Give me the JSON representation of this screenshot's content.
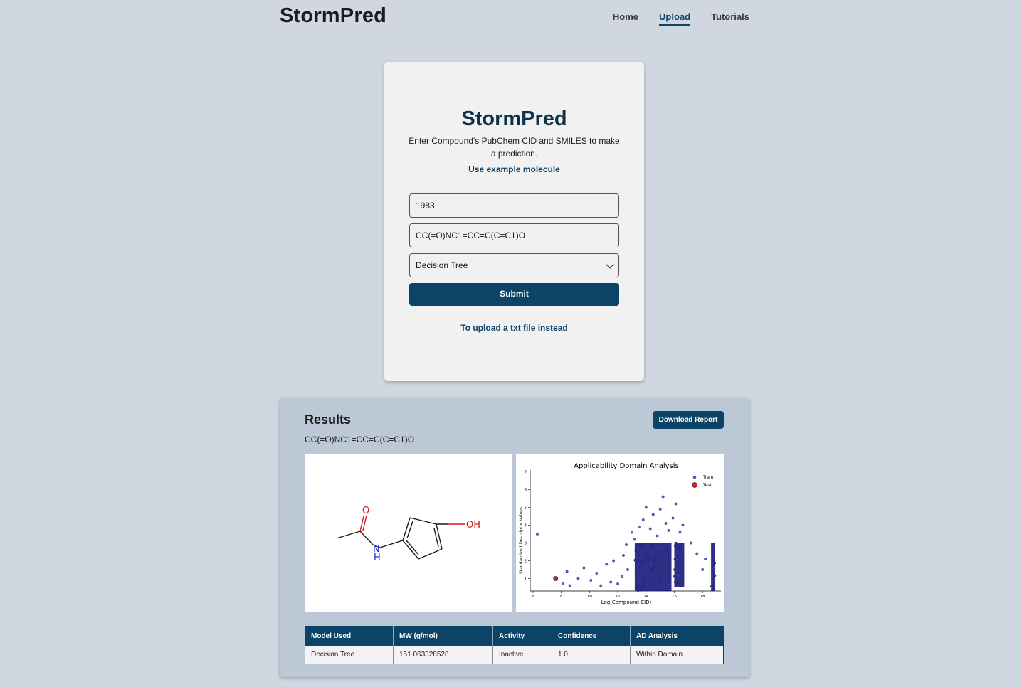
{
  "brand": "StormPred",
  "nav": {
    "home": "Home",
    "upload": "Upload",
    "tutorials": "Tutorials",
    "active": "Upload"
  },
  "form": {
    "title": "StormPred",
    "subtitle": "Enter Compound's PubChem CID and SMILES to make a prediction.",
    "example_link": "Use example molecule",
    "cid_value": "1983",
    "smiles_value": "CC(=O)NC1=CC=C(C=C1)O",
    "model_selected": "Decision Tree",
    "submit_label": "Submit",
    "upload_link": "To upload a txt file instead"
  },
  "results": {
    "title": "Results",
    "download_label": "Download Report",
    "smiles": "CC(=O)NC1=CC=C(C=C1)O",
    "molecule_labels": {
      "o": "O",
      "n": "N",
      "h": "H",
      "oh": "OH"
    },
    "table": {
      "headers": [
        "Model Used",
        "MW (g/mol)",
        "Activity",
        "Confidence",
        "AD Analysis"
      ],
      "row": [
        "Decision Tree",
        "151.063328528",
        "Inactive",
        "1.0",
        "Within Domain"
      ]
    }
  },
  "chart_data": {
    "type": "scatter",
    "title": "Applicability Domain Analysis",
    "xlabel": "Log(Compound CID)",
    "ylabel": "Standardized Descriptor Values",
    "xlim": [
      5.8,
      19.3
    ],
    "ylim": [
      0.3,
      7.1
    ],
    "xticks": [
      6,
      8,
      10,
      12,
      14,
      16,
      18
    ],
    "yticks": [
      1,
      2,
      3,
      4,
      5,
      6,
      7
    ],
    "threshold": 3,
    "legend": [
      "Train",
      "Test"
    ],
    "legend_position": "top-right",
    "colors": {
      "train": "#1a1a8c",
      "test": "#e02020"
    },
    "series": [
      {
        "name": "Train",
        "points": [
          [
            6.3,
            3.5
          ],
          [
            8.4,
            1.4
          ],
          [
            8.1,
            0.7
          ],
          [
            8.6,
            0.6
          ],
          [
            9.2,
            1.0
          ],
          [
            9.6,
            1.6
          ],
          [
            10.1,
            0.9
          ],
          [
            10.5,
            1.3
          ],
          [
            10.8,
            0.6
          ],
          [
            11.2,
            1.8
          ],
          [
            11.5,
            0.8
          ],
          [
            11.7,
            2.0
          ],
          [
            12.0,
            0.7
          ],
          [
            12.3,
            1.1
          ],
          [
            12.4,
            2.3
          ],
          [
            12.6,
            2.9
          ],
          [
            12.7,
            1.5
          ],
          [
            13.0,
            3.6
          ],
          [
            13.2,
            3.2
          ],
          [
            13.5,
            3.9
          ],
          [
            13.8,
            4.3
          ],
          [
            14.0,
            5.0
          ],
          [
            14.3,
            3.8
          ],
          [
            14.5,
            4.6
          ],
          [
            14.8,
            3.4
          ],
          [
            15.0,
            4.9
          ],
          [
            15.2,
            5.6
          ],
          [
            15.4,
            4.1
          ],
          [
            15.6,
            3.7
          ],
          [
            15.9,
            4.4
          ],
          [
            16.1,
            5.2
          ],
          [
            16.4,
            3.6
          ],
          [
            16.6,
            4.0
          ],
          [
            17.2,
            3.0
          ],
          [
            17.6,
            2.4
          ],
          [
            18.0,
            1.5
          ],
          [
            18.2,
            2.1
          ]
        ],
        "dense_regions": [
          {
            "x": [
              13.2,
              15.8
            ],
            "y": [
              0.3,
              3.0
            ]
          },
          {
            "x": [
              16.0,
              16.7
            ],
            "y": [
              0.5,
              3.0
            ]
          },
          {
            "x": [
              18.6,
              18.9
            ],
            "y": [
              0.3,
              3.0
            ]
          }
        ]
      },
      {
        "name": "Test",
        "points": [
          [
            7.6,
            1.0
          ]
        ]
      }
    ]
  }
}
